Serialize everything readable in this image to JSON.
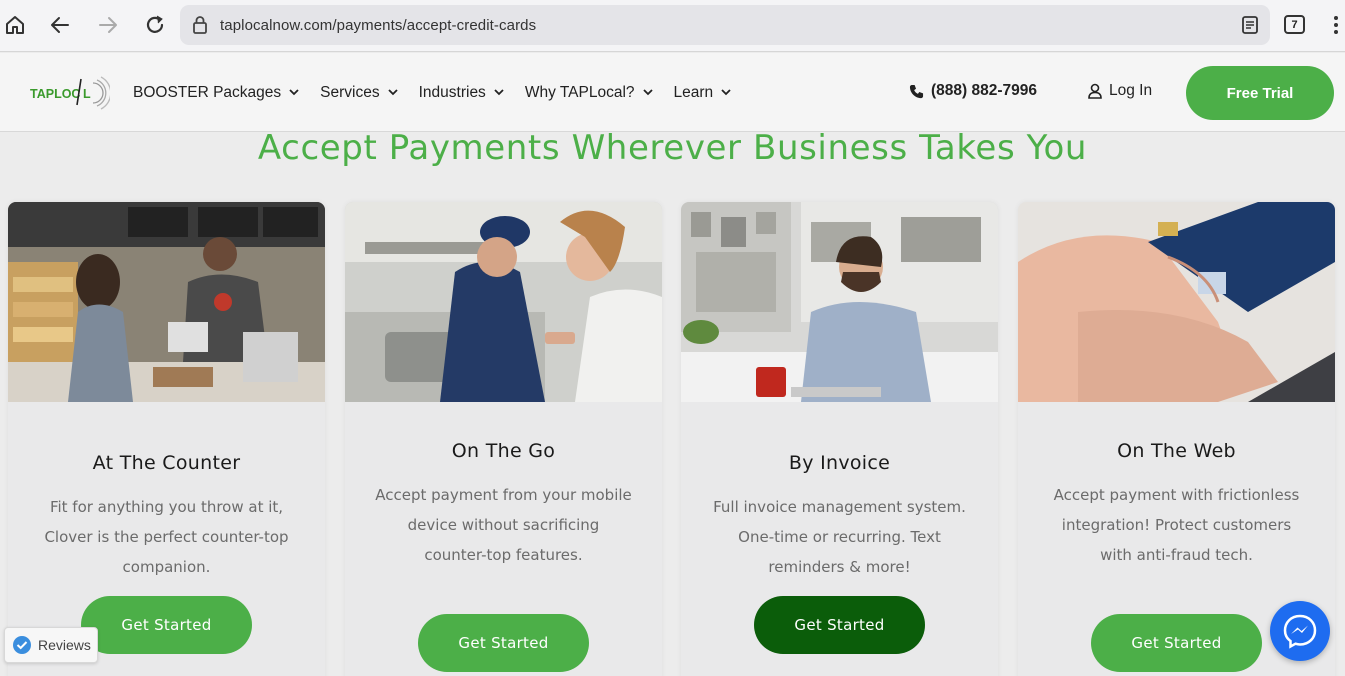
{
  "browser": {
    "url": "taplocalnow.com/payments/accept-credit-cards",
    "tab_count": "7",
    "icons": [
      "home-icon",
      "back-icon",
      "forward-icon",
      "reload-icon",
      "lock-icon",
      "reader-icon",
      "tabs-icon",
      "menu-icon"
    ]
  },
  "header": {
    "logo_text": "TAPLOC",
    "logo_suffix": "L",
    "nav": [
      {
        "label": "BOOSTER Packages"
      },
      {
        "label": "Services"
      },
      {
        "label": "Industries"
      },
      {
        "label": "Why TAPLocal?"
      },
      {
        "label": "Learn"
      }
    ],
    "phone": "(888) 882-7996",
    "login": "Log In",
    "cta": "Free Trial",
    "accent_color": "#4caf48"
  },
  "main": {
    "headline": "Accept Payments Wherever Business Takes You",
    "cards": [
      {
        "title": "At The Counter",
        "desc": "Fit for anything you throw at it, Clover is the perfect counter-top companion.",
        "button": "Get Started"
      },
      {
        "title": "On The Go",
        "desc": "Accept payment from your mobile device without sacrificing counter-top features.",
        "button": "Get Started"
      },
      {
        "title": "By Invoice",
        "desc": "Full invoice management system. One-time or recurring. Text reminders & more!",
        "button": "Get Started"
      },
      {
        "title": "On The Web",
        "desc": "Accept payment with frictionless integration! Protect customers with anti-fraud tech.",
        "button": "Get Started"
      }
    ]
  },
  "widgets": {
    "reviews_label": "Reviews",
    "messenger_icon": "messenger-icon"
  }
}
